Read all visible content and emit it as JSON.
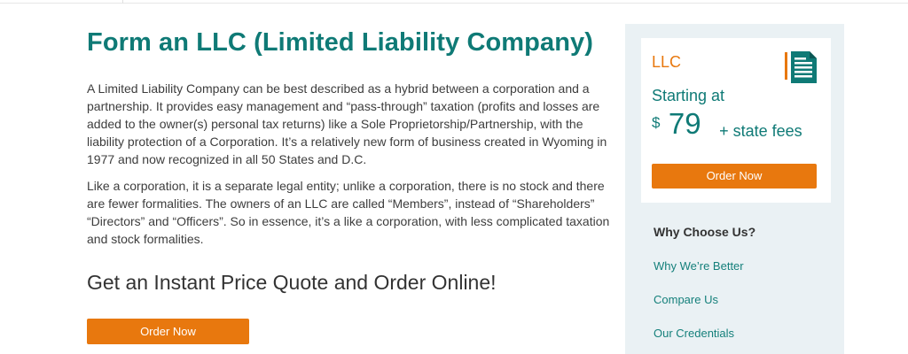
{
  "main": {
    "title": "Form an LLC (Limited Liability Company)",
    "paragraphs": [
      "A Limited Liability Company can be best described as a hybrid between a corporation and a partnership. It provides easy management and “pass-through” taxation (profits and losses are added to the owner(s) personal tax returns) like a Sole Proprietorship/Partnership, with the liability protection of a Corporation. It’s a relatively new form of business created in Wyoming in 1977 and now recognized in all 50 States and D.C.",
      "Like a corporation, it is a separate legal entity; unlike a corporation, there is no stock and there are fewer formalities. The owners of an LLC are called “Members”, instead of “Shareholders” “Directors” and “Officers”. So in essence, it’s a like a corporation, with less complicated taxation and stock formalities."
    ],
    "subheading": "Get an Instant Price Quote and Order Online!",
    "order_label": "Order Now"
  },
  "sidebar": {
    "card": {
      "label": "LLC",
      "icon": "document-icon",
      "starting_text": "Starting at",
      "currency": "$",
      "amount": "79",
      "fees": "+ state fees",
      "order_label": "Order Now"
    },
    "why": {
      "title": "Why Choose Us?",
      "links": [
        "Why We’re Better",
        "Compare Us",
        "Our Credentials"
      ]
    }
  },
  "colors": {
    "teal": "#0f7a76",
    "orange": "#e8780e",
    "sidebar_bg": "#eaf1f4"
  }
}
